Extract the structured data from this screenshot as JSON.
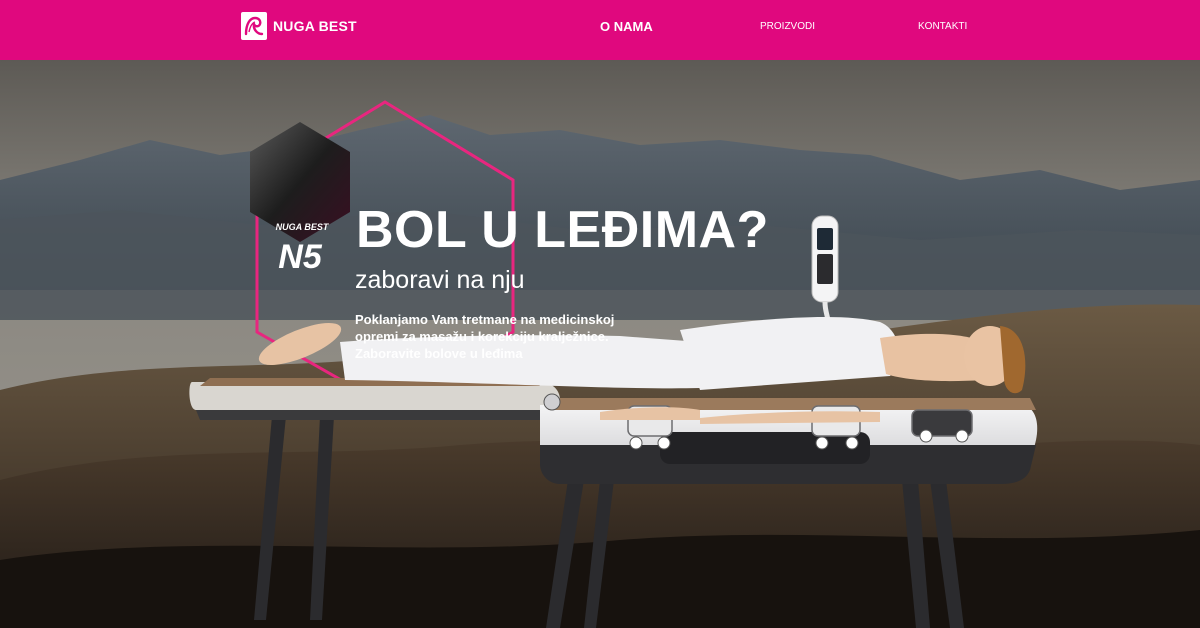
{
  "brand": {
    "name": "NUGA BEST"
  },
  "nav": {
    "active": "O NAMA",
    "items": [
      "PROIZVODI",
      "KONTAKTI"
    ]
  },
  "hero": {
    "badge_brand": "NUGA BEST",
    "badge_model": "N5",
    "headline": "BOL U LEĐIMA?",
    "subheadline": "zaboravi na nju",
    "lead": "Poklanjamo Vam tretmane na medicinskoj opremi za masažu i korekciju kralježnice. Zaboravite bolove u leđima"
  },
  "colors": {
    "accent": "#e0087e",
    "hexagon_outline": "#e8267f",
    "text": "#ffffff"
  },
  "icons": [
    "nuga-best-logo-icon",
    "n5-badge-icon"
  ]
}
